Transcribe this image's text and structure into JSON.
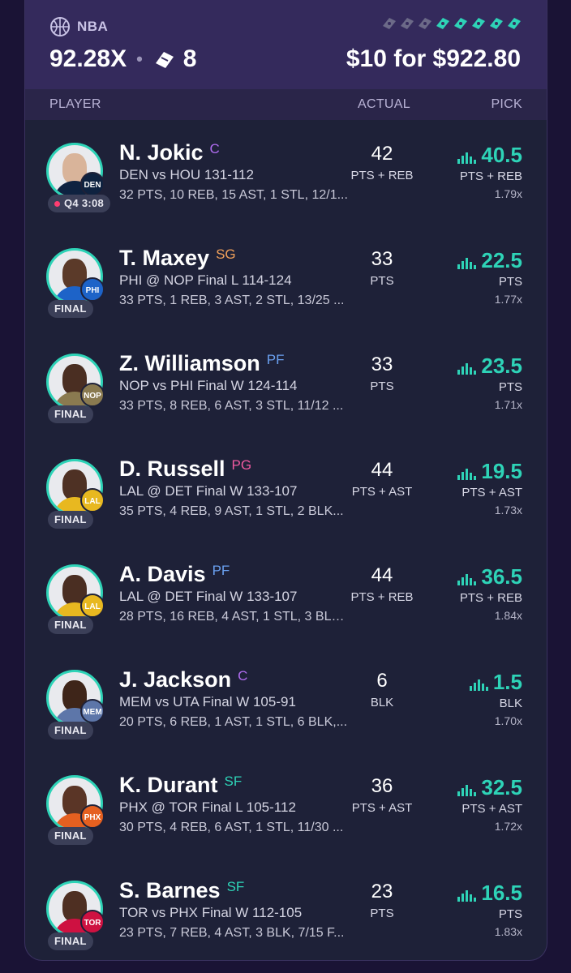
{
  "header": {
    "league": "NBA",
    "multiplier": "92.28X",
    "legs": "8",
    "payout": "$10 for $922.80"
  },
  "columns": {
    "player": "PLAYER",
    "actual": "ACTUAL",
    "pick": "PICK"
  },
  "colors": {
    "accent": "#2ed3b7",
    "header_bg": "#342a5c",
    "card_bg": "#1e2138"
  },
  "rows": [
    {
      "name": "N. Jokic",
      "position": "C",
      "position_color": "#b06cf0",
      "game": "DEN vs HOU  131-112",
      "stats": "32 PTS, 10 REB, 15 AST, 1 STL, 12/1...",
      "status": "Q4 3:08",
      "live": true,
      "team": "DEN",
      "team_color": "#0e2240",
      "skin": "#d9b49a",
      "actual": "42",
      "actual_stat": "PTS + REB",
      "pick": "40.5",
      "pick_stat": "PTS + REB",
      "pick_mult": "1.79x"
    },
    {
      "name": "T. Maxey",
      "position": "SG",
      "position_color": "#f0a05a",
      "game": "PHI @ NOP Final L 114-124",
      "stats": "33 PTS, 1 REB, 3 AST, 2 STL, 13/25 ...",
      "status": "FINAL",
      "live": false,
      "team": "PHI",
      "team_color": "#1d63c8",
      "skin": "#5b3a29",
      "actual": "33",
      "actual_stat": "PTS",
      "pick": "22.5",
      "pick_stat": "PTS",
      "pick_mult": "1.77x"
    },
    {
      "name": "Z. Williamson",
      "position": "PF",
      "position_color": "#6aa0f0",
      "game": "NOP vs PHI Final W 124-114",
      "stats": "33 PTS, 8 REB, 6 AST, 3 STL, 11/12 ...",
      "status": "FINAL",
      "live": false,
      "team": "NOP",
      "team_color": "#8a7a50",
      "skin": "#4a2e22",
      "actual": "33",
      "actual_stat": "PTS",
      "pick": "23.5",
      "pick_stat": "PTS",
      "pick_mult": "1.71x"
    },
    {
      "name": "D. Russell",
      "position": "PG",
      "position_color": "#f05aa0",
      "game": "LAL @ DET Final W 133-107",
      "stats": "35 PTS, 4 REB, 9 AST, 1 STL, 2 BLK...",
      "status": "FINAL",
      "live": false,
      "team": "LAL",
      "team_color": "#e8b820",
      "skin": "#4e3124",
      "actual": "44",
      "actual_stat": "PTS + AST",
      "pick": "19.5",
      "pick_stat": "PTS + AST",
      "pick_mult": "1.73x"
    },
    {
      "name": "A. Davis",
      "position": "PF",
      "position_color": "#6aa0f0",
      "game": "LAL @ DET Final W 133-107",
      "stats": "28 PTS, 16 REB, 4 AST, 1 STL, 3 BLK,...",
      "status": "FINAL",
      "live": false,
      "team": "LAL",
      "team_color": "#e8b820",
      "skin": "#4a2e22",
      "actual": "44",
      "actual_stat": "PTS + REB",
      "pick": "36.5",
      "pick_stat": "PTS + REB",
      "pick_mult": "1.84x"
    },
    {
      "name": "J. Jackson",
      "position": "C",
      "position_color": "#b06cf0",
      "game": "MEM vs UTA Final W 105-91",
      "stats": "20 PTS, 6 REB, 1 AST, 1 STL, 6 BLK,...",
      "status": "FINAL",
      "live": false,
      "team": "MEM",
      "team_color": "#5d76a9",
      "skin": "#3e2519",
      "actual": "6",
      "actual_stat": "BLK",
      "pick": "1.5",
      "pick_stat": "BLK",
      "pick_mult": "1.70x"
    },
    {
      "name": "K. Durant",
      "position": "SF",
      "position_color": "#2ed3b7",
      "game": "PHX @ TOR Final L 105-112",
      "stats": "30 PTS, 4 REB, 6 AST, 1 STL, 11/30 ...",
      "status": "FINAL",
      "live": false,
      "team": "PHX",
      "team_color": "#e56020",
      "skin": "#5a3526",
      "actual": "36",
      "actual_stat": "PTS + AST",
      "pick": "32.5",
      "pick_stat": "PTS + AST",
      "pick_mult": "1.72x"
    },
    {
      "name": "S. Barnes",
      "position": "SF",
      "position_color": "#2ed3b7",
      "game": "TOR vs PHX Final W 112-105",
      "stats": "23 PTS, 7 REB, 4 AST, 3 BLK, 7/15 F...",
      "status": "FINAL",
      "live": false,
      "team": "TOR",
      "team_color": "#ce1141",
      "skin": "#4e2f22",
      "actual": "23",
      "actual_stat": "PTS",
      "pick": "16.5",
      "pick_stat": "PTS",
      "pick_mult": "1.83x"
    }
  ]
}
